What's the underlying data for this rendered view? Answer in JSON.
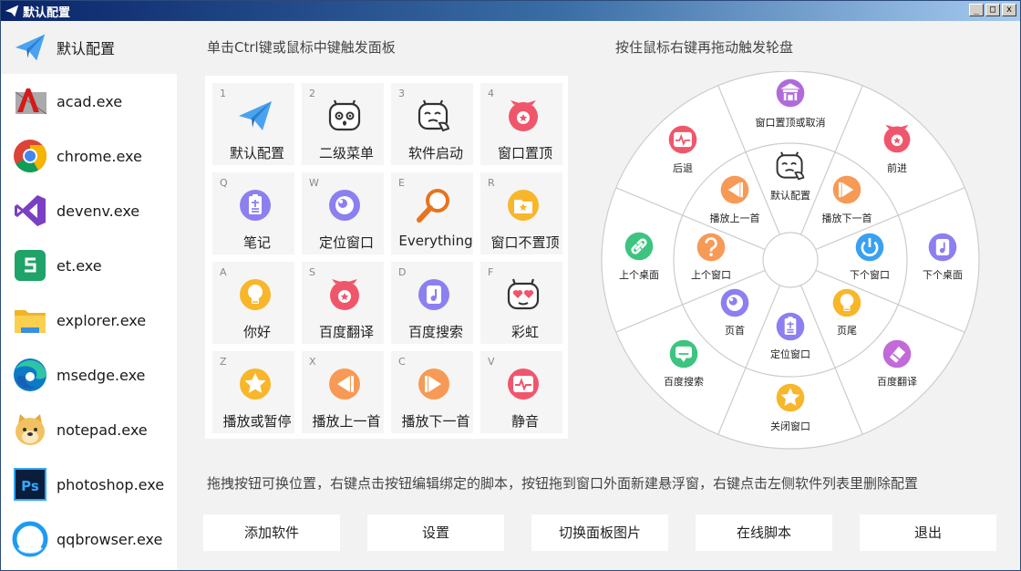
{
  "window": {
    "title": "默认配置",
    "minimize_label": "_",
    "maximize_label": "□",
    "close_label": "x"
  },
  "sidebar": {
    "header": {
      "label": "默认配置",
      "icon": "paper-plane-icon"
    },
    "items": [
      {
        "label": "acad.exe",
        "icon": "autocad-icon"
      },
      {
        "label": "chrome.exe",
        "icon": "chrome-icon"
      },
      {
        "label": "devenv.exe",
        "icon": "visual-studio-icon"
      },
      {
        "label": "et.exe",
        "icon": "wps-spreadsheet-icon"
      },
      {
        "label": "explorer.exe",
        "icon": "folder-icon"
      },
      {
        "label": "msedge.exe",
        "icon": "edge-icon"
      },
      {
        "label": "notepad.exe",
        "icon": "notepad-doge-icon"
      },
      {
        "label": "photoshop.exe",
        "icon": "photoshop-icon"
      },
      {
        "label": "qqbrowser.exe",
        "icon": "qqbrowser-icon"
      }
    ]
  },
  "left_title": "单击Ctrl键或鼠标中键触发面板",
  "right_title": "按住鼠标右键再拖动触发轮盘",
  "panel": {
    "cells": [
      {
        "key": "1",
        "label": "默认配置",
        "icon": "paper-plane-icon"
      },
      {
        "key": "2",
        "label": "二级菜单",
        "icon": "surprised-face-icon"
      },
      {
        "key": "3",
        "label": "软件启动",
        "icon": "thinking-face-icon"
      },
      {
        "key": "4",
        "label": "窗口置顶",
        "icon": "pig-badge-icon"
      },
      {
        "key": "Q",
        "label": "笔记",
        "icon": "note-icon"
      },
      {
        "key": "W",
        "label": "定位窗口",
        "icon": "moon-target-icon"
      },
      {
        "key": "E",
        "label": "Everything",
        "icon": "magnifier-icon"
      },
      {
        "key": "R",
        "label": "窗口不置顶",
        "icon": "folder-star-icon"
      },
      {
        "key": "A",
        "label": "你好",
        "icon": "lightbulb-icon"
      },
      {
        "key": "S",
        "label": "百度翻译",
        "icon": "pig-badge-icon"
      },
      {
        "key": "D",
        "label": "百度搜索",
        "icon": "music-file-icon"
      },
      {
        "key": "F",
        "label": "彩虹",
        "icon": "heart-eyes-face-icon"
      },
      {
        "key": "Z",
        "label": "播放或暂停",
        "icon": "star-badge-icon"
      },
      {
        "key": "X",
        "label": "播放上一首",
        "icon": "previous-track-icon"
      },
      {
        "key": "C",
        "label": "播放下一首",
        "icon": "next-track-icon"
      },
      {
        "key": "V",
        "label": "静音",
        "icon": "pulse-icon"
      }
    ]
  },
  "wheel": {
    "outer": [
      {
        "label": "窗口置顶或取消",
        "icon": "temple-icon",
        "color": "#b06ad9"
      },
      {
        "label": "前进",
        "icon": "pig-badge-icon",
        "color": "#f0566b"
      },
      {
        "label": "下个桌面",
        "icon": "music-file-icon",
        "color": "#8c7ff0"
      },
      {
        "label": "百度翻译",
        "icon": "eraser-icon",
        "color": "#c36ad9"
      },
      {
        "label": "关闭窗口",
        "icon": "star-badge-icon",
        "color": "#f8b62b"
      },
      {
        "label": "百度搜索",
        "icon": "chat-icon",
        "color": "#3dc480"
      },
      {
        "label": "上个桌面",
        "icon": "link-icon",
        "color": "#3dc480"
      },
      {
        "label": "后退",
        "icon": "pulse-icon",
        "color": "#f0566b"
      }
    ],
    "inner": [
      {
        "label": "默认配置",
        "icon": "thinking-face-icon",
        "color": "#5a6b8a"
      },
      {
        "label": "播放下一首",
        "icon": "next-track-icon",
        "color": "#f79a55"
      },
      {
        "label": "下个窗口",
        "icon": "power-icon",
        "color": "#3aa0f0"
      },
      {
        "label": "页尾",
        "icon": "lightbulb-icon",
        "color": "#f8b62b"
      },
      {
        "label": "定位窗口",
        "icon": "note-icon",
        "color": "#8c7ff0"
      },
      {
        "label": "页首",
        "icon": "moon-target-icon",
        "color": "#8c7ff0"
      },
      {
        "label": "上个窗口",
        "icon": "question-icon",
        "color": "#f79a55"
      },
      {
        "label": "播放上一首",
        "icon": "previous-track-icon",
        "color": "#f79a55"
      }
    ]
  },
  "hint": "拖拽按钮可换位置，右键点击按钮编辑绑定的脚本，按钮拖到窗口外面新建悬浮窗，右键点击左侧软件列表里删除配置",
  "buttons": {
    "add": "添加软件",
    "settings": "设置",
    "switch_image": "切换面板图片",
    "online_script": "在线脚本",
    "exit": "退出"
  },
  "colors": {
    "blue": "#3aa0f0",
    "purple": "#8c7ff0",
    "red": "#f0566b",
    "orange": "#f79a55",
    "yellow": "#f8b62b",
    "green": "#3dc480"
  }
}
